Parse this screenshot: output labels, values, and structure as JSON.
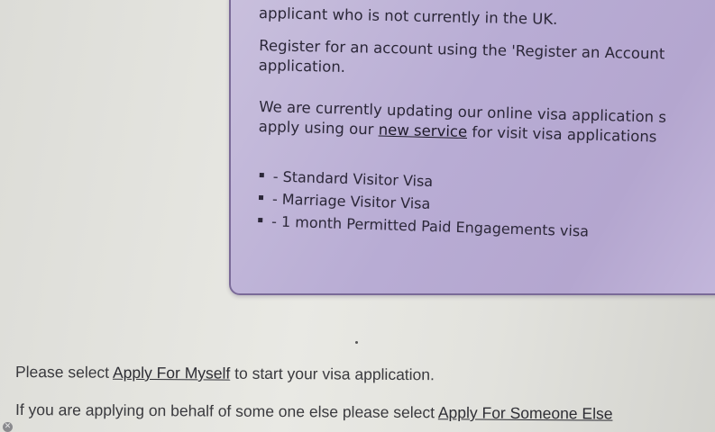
{
  "panel": {
    "top_line": "applicant who is not currently in the UK.",
    "register_line_1": "Register for an account using the 'Register an Account",
    "register_line_2": "application.",
    "update_line_1": "We are currently updating our online visa application s",
    "update_prefix": "apply using our ",
    "new_service_link": "new service",
    "update_suffix": " for visit visa applications",
    "visa_types": [
      "- Standard Visitor Visa",
      "- Marriage Visitor Visa",
      "- 1 month Permitted Paid Engagements visa"
    ]
  },
  "main": {
    "line1_prefix": "Please select ",
    "apply_myself_link": "Apply For Myself",
    "line1_suffix": " to start your visa application.",
    "line2_prefix": "If you are applying on behalf of some one else please select ",
    "apply_someone_link": "Apply For Someone Else"
  },
  "icons": {
    "close": "close-icon"
  }
}
